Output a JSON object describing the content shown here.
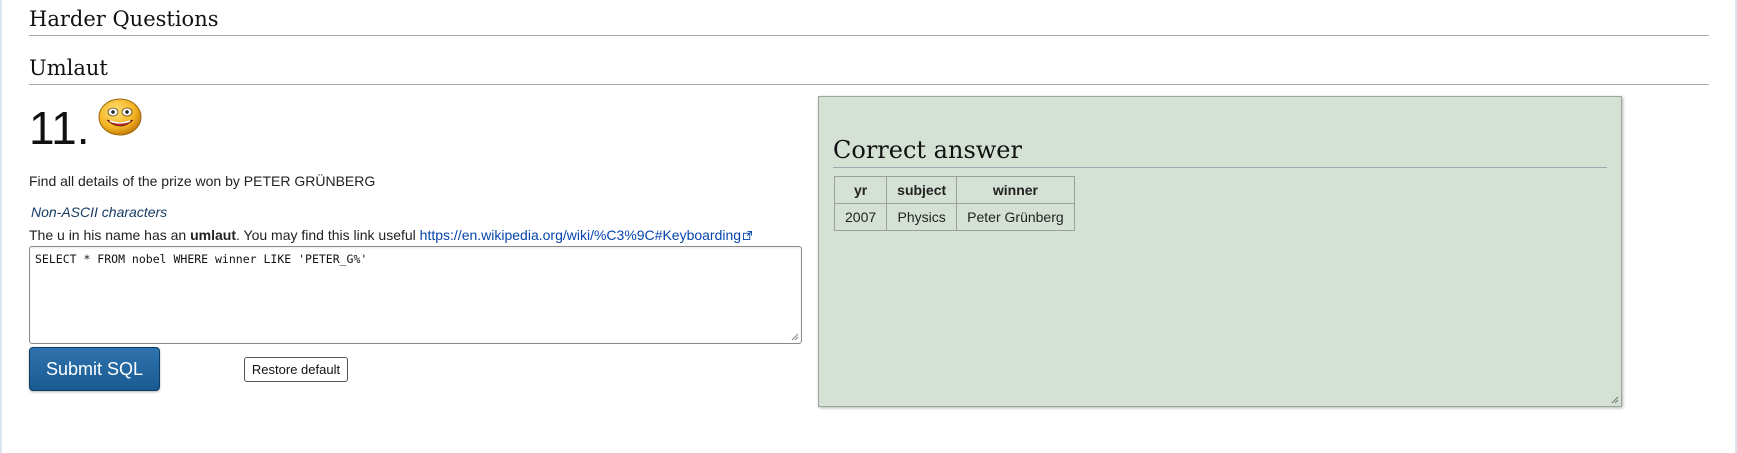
{
  "sections": {
    "harder": "Harder Questions",
    "umlaut": "Umlaut"
  },
  "question": {
    "number": "11.",
    "prompt": "Find all details of the prize won by PETER GRÜNBERG",
    "hint_title": "Non-ASCII characters",
    "hint_pre": "The u in his name has an ",
    "hint_bold": "umlaut",
    "hint_post": ". You may find this link useful ",
    "hint_link": "https://en.wikipedia.org/wiki/%C3%9C#Keyboarding"
  },
  "editor": {
    "sql": "SELECT * FROM nobel WHERE winner LIKE 'PETER_G%'"
  },
  "buttons": {
    "submit": "Submit SQL",
    "restore": "Restore default"
  },
  "answer": {
    "title": "Correct answer",
    "columns": [
      "yr",
      "subject",
      "winner"
    ],
    "rows": [
      [
        "2007",
        "Physics",
        "Peter Grünberg"
      ]
    ]
  },
  "colors": {
    "panel_bg": "#d5e1d5",
    "submit_bg": "#1f6299",
    "link": "#0645ad"
  }
}
